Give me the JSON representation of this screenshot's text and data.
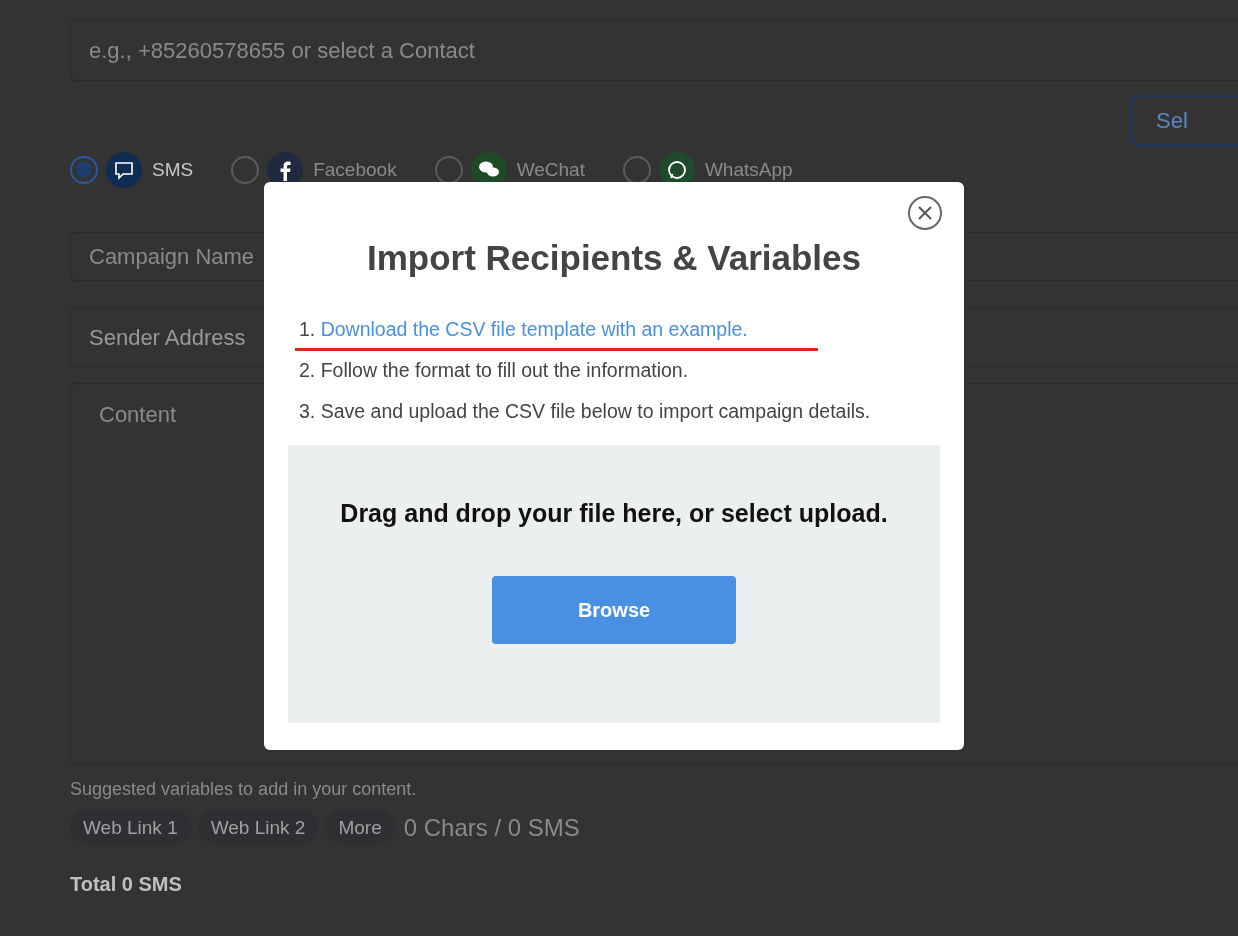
{
  "page": {
    "recipient_field": {
      "placeholder": "e.g., +85260578655 or select a Contact"
    },
    "select_button": "Sel",
    "channels": [
      {
        "label": "SMS",
        "kind": "sms",
        "selected": true
      },
      {
        "label": "Facebook",
        "kind": "facebook",
        "selected": false
      },
      {
        "label": "WeChat",
        "kind": "wechat",
        "selected": false
      },
      {
        "label": "WhatsApp",
        "kind": "whatsapp",
        "selected": false
      }
    ],
    "campaign_name": {
      "placeholder": "Campaign Name"
    },
    "sender_address": {
      "label": "Sender Address"
    },
    "content": {
      "placeholder": "Content"
    },
    "variables_hint": "Suggested variables to add in your content.",
    "variable_chips": [
      "Web Link 1",
      "Web Link 2",
      "More"
    ],
    "char_count": "0 Chars / 0 SMS",
    "total": "Total 0 SMS"
  },
  "dialog": {
    "title": "Import Recipients & Variables",
    "steps": [
      {
        "number": "1.",
        "text": "Download the CSV file template with an example.",
        "kind": "link"
      },
      {
        "number": "2.",
        "text": "Follow the format to fill out the information.",
        "kind": "plain"
      },
      {
        "number": "3.",
        "text": "Save and upload the CSV file below to import campaign details.",
        "kind": "plain"
      }
    ],
    "dropzone": {
      "text": "Drag and drop your file here, or select upload.",
      "button": "Browse"
    }
  }
}
